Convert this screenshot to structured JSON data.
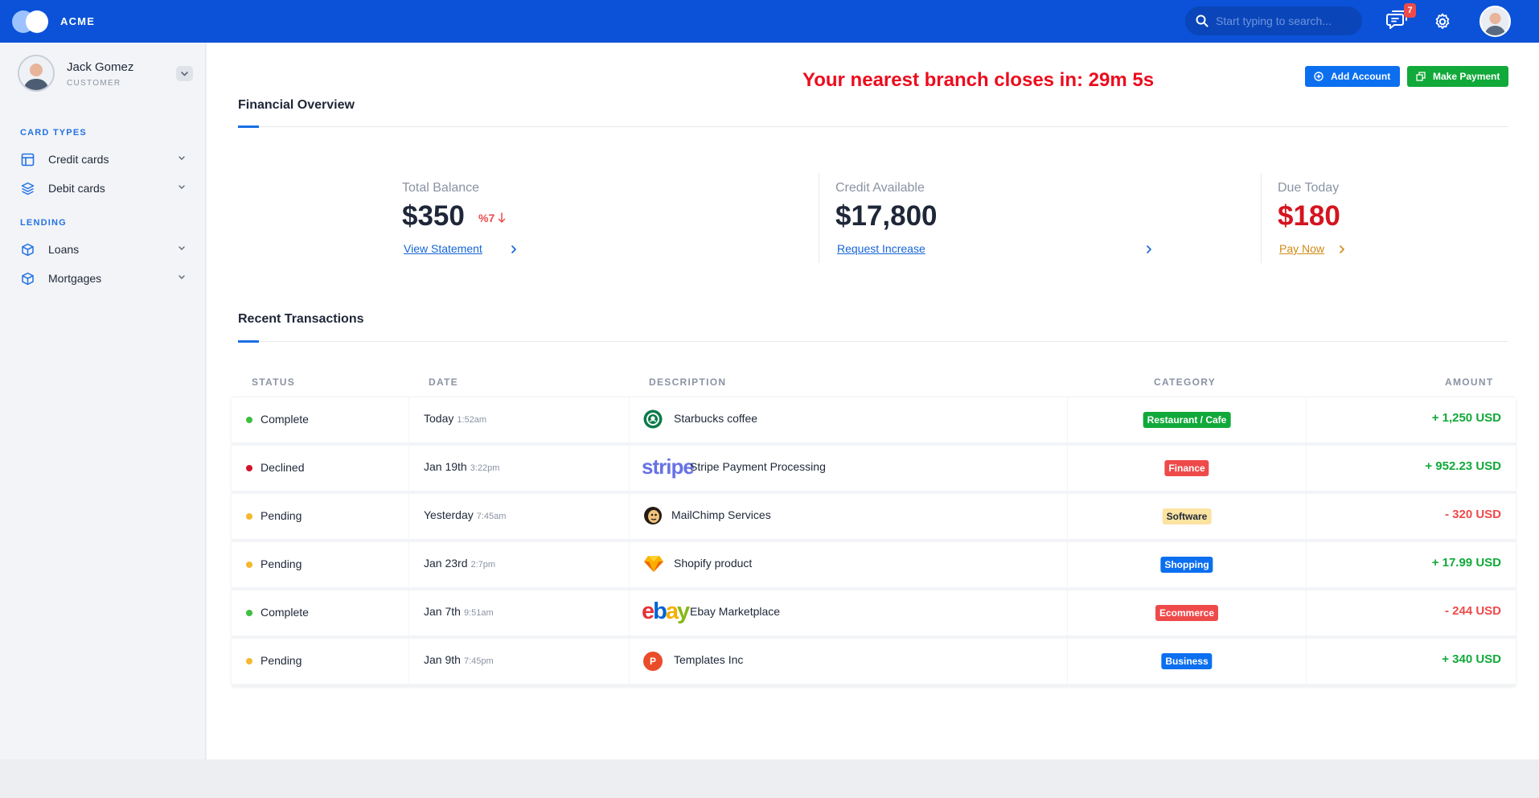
{
  "topbar": {
    "brand": "ACME",
    "search_placeholder": "Start typing to search...",
    "notification_count": "7",
    "brand_color": "#0b52d8"
  },
  "sidebar": {
    "user_name": "Jack Gomez",
    "user_role": "CUSTOMER",
    "sections": [
      {
        "title": "CARD TYPES",
        "items": [
          {
            "label": "Credit cards",
            "icon": "table-icon"
          },
          {
            "label": "Debit cards",
            "icon": "layers-icon"
          }
        ]
      },
      {
        "title": "LENDING",
        "items": [
          {
            "label": "Loans",
            "icon": "box-icon"
          },
          {
            "label": "Mortgages",
            "icon": "box-icon"
          }
        ]
      }
    ]
  },
  "main": {
    "countdown": "Your nearest branch closes in: 29m 5s",
    "add_account_label": "Add Account",
    "make_payment_label": "Make Payment",
    "overview_title": "Financial Overview",
    "stats": {
      "total_balance": {
        "label": "Total Balance",
        "value": "$350",
        "trend": "%7",
        "link": "View Statement"
      },
      "credit_available": {
        "label": "Credit Available",
        "value": "$17,800",
        "link": "Request Increase"
      },
      "due_today": {
        "label": "Due Today",
        "value": "$180",
        "link": "Pay Now"
      }
    },
    "transactions_title": "Recent Transactions",
    "columns": {
      "status": "STATUS",
      "date": "DATE",
      "description": "DESCRIPTION",
      "category": "CATEGORY",
      "amount": "AMOUNT"
    },
    "transactions": [
      {
        "status": "Complete",
        "date": "Today",
        "time": "1:52am",
        "description": "Starbucks coffee",
        "category": "Restaurant / Cafe",
        "amount": "+ 1,250 USD"
      },
      {
        "status": "Declined",
        "date": "Jan 19th",
        "time": "3:22pm",
        "description": "Stripe Payment Processing",
        "logo_text": "stripe",
        "category": "Finance",
        "amount": "+ 952.23 USD"
      },
      {
        "status": "Pending",
        "date": "Yesterday",
        "time": "7:45am",
        "description": "MailChimp Services",
        "category": "Software",
        "amount": "- 320 USD"
      },
      {
        "status": "Pending",
        "date": "Jan 23rd",
        "time": "2:7pm",
        "description": "Shopify product",
        "category": "Shopping",
        "amount": "+ 17.99 USD"
      },
      {
        "status": "Complete",
        "date": "Jan 7th",
        "time": "9:51am",
        "description": "Ebay Marketplace",
        "logo_text": "ebay",
        "category": "Ecommerce",
        "amount": "- 244 USD"
      },
      {
        "status": "Pending",
        "date": "Jan 9th",
        "time": "7:45pm",
        "description": "Templates Inc",
        "logo_text": "P",
        "category": "Business",
        "amount": "+ 340 USD"
      }
    ],
    "status_colors": {
      "Complete": "#3fbf3f",
      "Declined": "#d3132c",
      "Pending": "#f5b82e"
    },
    "category_colors": {
      "Restaurant / Cafe": "#11a93a",
      "Finance": "#ef4a4a",
      "Software": "#fbe3a2",
      "Shopping": "#0b6ff0",
      "Ecommerce": "#ef4a4a",
      "Business": "#0b6ff0"
    }
  }
}
